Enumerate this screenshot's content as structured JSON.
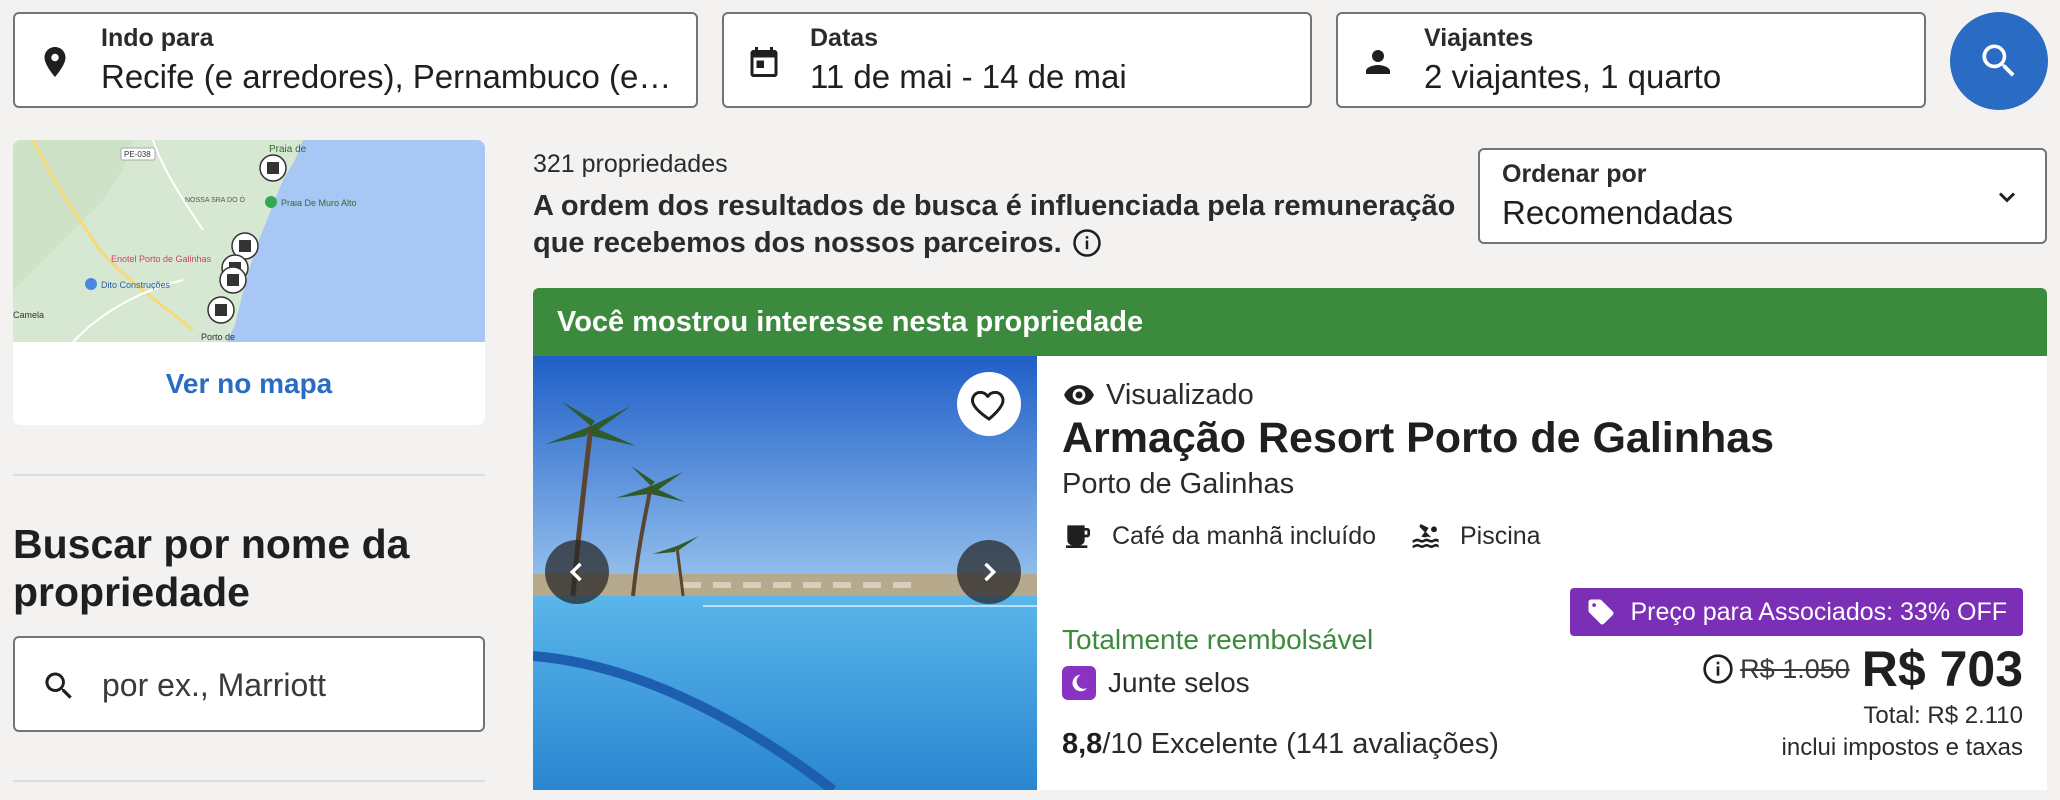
{
  "search": {
    "destination": {
      "label": "Indo para",
      "value": "Recife (e arredores), Pernambuco (es..."
    },
    "dates": {
      "label": "Datas",
      "value": "11 de mai - 14 de mai"
    },
    "travelers": {
      "label": "Viajantes",
      "value": "2 viajantes, 1 quarto"
    }
  },
  "map": {
    "labels": [
      "Praia de",
      "NOSSA SRA DO Ó",
      "Praia De Muro Alto",
      "Enotel Porto de Galinhas",
      "Dito Construções",
      "Camela",
      "Porto de",
      "PE-038"
    ],
    "link": "Ver no mapa"
  },
  "name_search": {
    "heading": "Buscar por nome da propriedade",
    "placeholder": "por ex., Marriott"
  },
  "results": {
    "count": "321 propriedades",
    "disclaimer": "A ordem dos resultados de busca é influenciada pela remuneração que recebemos dos nossos parceiros."
  },
  "sort": {
    "label": "Ordenar por",
    "value": "Recomendadas"
  },
  "listing": {
    "banner": "Você mostrou interesse nesta propriedade",
    "viewed": "Visualizado",
    "name": "Armação Resort Porto de Galinhas",
    "location": "Porto de Galinhas",
    "amenities": [
      "Café da manhã incluído",
      "Piscina"
    ],
    "refund": "Totalmente reembolsável",
    "stamps": "Junte selos",
    "rating_score": "8,8",
    "rating_rest": "/10 Excelente (141 avaliações)",
    "member_badge": "Preço para Associados: 33% OFF",
    "old_price": "R$ 1.050",
    "price": "R$ 703",
    "total": "Total: R$ 2.110",
    "taxes": "inclui impostos e taxas"
  },
  "colors": {
    "accent": "#2a6bc3",
    "banner_green": "#3c8a3e",
    "member_purple": "#7b2fb6"
  }
}
